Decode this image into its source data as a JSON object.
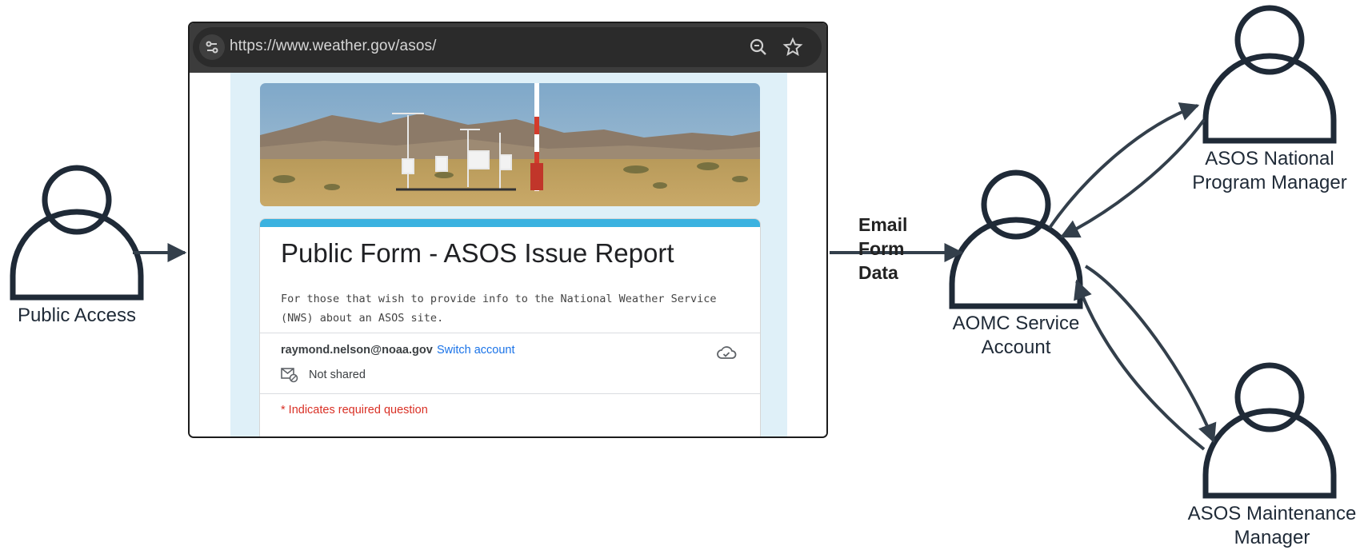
{
  "diagram": {
    "actors": [
      {
        "id": "public",
        "label_lines": [
          "Public Access"
        ]
      },
      {
        "id": "aomc",
        "label_lines": [
          "AOMC Service",
          "Account"
        ]
      },
      {
        "id": "national",
        "label_lines": [
          "ASOS National",
          "Program Manager"
        ]
      },
      {
        "id": "maintenance",
        "label_lines": [
          "ASOS Maintenance",
          "Manager"
        ]
      }
    ],
    "edge_label_lines": [
      "Email",
      "Form",
      "Data"
    ],
    "colors": {
      "actor_stroke": "#1f2a37",
      "arrow": "#333f4b"
    }
  },
  "browser": {
    "url": "https://www.weather.gov/asos/",
    "icons": [
      "site-settings-icon",
      "zoom-icon",
      "star-icon"
    ],
    "form": {
      "title": "Public Form - ASOS Issue Report",
      "description": "For those that wish to provide info to the National Weather Service (NWS) about an ASOS site.",
      "account_email": "raymond.nelson@noaa.gov",
      "switch_account": "Switch account",
      "not_shared": "Not shared",
      "required_note": "* Indicates required question",
      "accent_color": "#3bb2e0"
    }
  }
}
